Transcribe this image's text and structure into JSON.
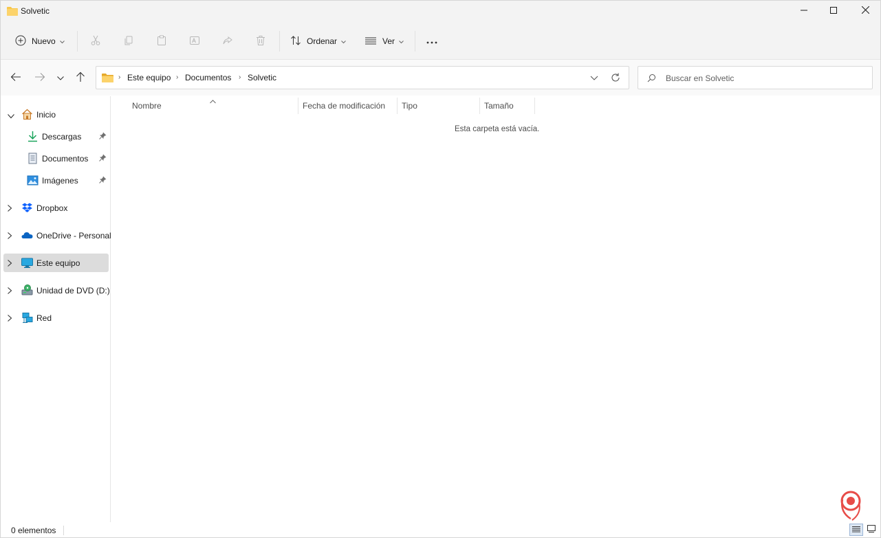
{
  "window": {
    "title": "Solvetic",
    "folder_icon": "folder-icon",
    "controls": [
      "minimize-icon",
      "maximize-icon",
      "close-icon"
    ]
  },
  "toolbar": {
    "new_label": "Nuevo",
    "sort_label": "Ordenar",
    "view_label": "Ver",
    "disabled_icons": [
      "cut-icon",
      "copy-icon",
      "paste-icon",
      "rename-icon",
      "share-icon",
      "delete-icon"
    ],
    "more_icon": "more-icon"
  },
  "navigation": {
    "buttons": [
      "back-icon",
      "forward-icon",
      "recent-icon",
      "up-icon"
    ]
  },
  "address": {
    "breadcrumbs": [
      "Este equipo",
      "Documentos",
      "Solvetic"
    ]
  },
  "search": {
    "placeholder": "Buscar en Solvetic"
  },
  "sidebar": {
    "items": [
      {
        "label": "Inicio",
        "icon": "home-icon",
        "expanded": true
      },
      {
        "label": "Descargas",
        "icon": "download-icon",
        "pinned": true
      },
      {
        "label": "Documentos",
        "icon": "document-icon",
        "pinned": true
      },
      {
        "label": "Imágenes",
        "icon": "image-icon",
        "pinned": true
      },
      {
        "label": "Dropbox",
        "icon": "dropbox-icon"
      },
      {
        "label": "OneDrive - Personal",
        "icon": "onedrive-icon"
      },
      {
        "label": "Este equipo",
        "icon": "computer-icon",
        "selected": true
      },
      {
        "label": "Unidad de DVD (D:)",
        "icon": "dvd-icon"
      },
      {
        "label": "Red",
        "icon": "network-icon"
      }
    ]
  },
  "content": {
    "columns": [
      "Nombre",
      "Fecha de modificación",
      "Tipo",
      "Tamaño"
    ],
    "empty_message": "Esta carpeta está vacía."
  },
  "status": {
    "item_count": "0 elementos"
  },
  "colors": {
    "chrome_bg": "#f3f3f3",
    "selected_bg": "#dcdcdc",
    "folder_yellow": "#f8c74a",
    "accent_blue": "#0a64c2"
  }
}
